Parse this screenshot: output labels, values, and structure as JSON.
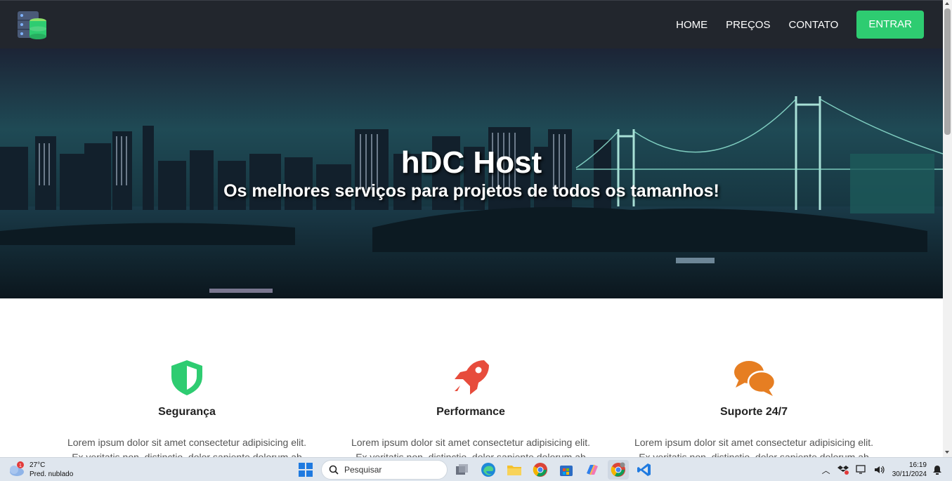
{
  "nav": {
    "links": [
      "HOME",
      "PREÇOS",
      "CONTATO"
    ],
    "button": "ENTRAR",
    "accent": "#2ecc71"
  },
  "hero": {
    "title": "hDC Host",
    "subtitle": "Os melhores serviços para projetos de todos os tamanhos!"
  },
  "features": [
    {
      "icon": "shield-icon",
      "title": "Segurança",
      "color": "#2ecc71",
      "text": "Lorem ipsum dolor sit amet consectetur adipisicing elit. Ex veritatis non, distinctio, dolor sapiente dolorum ab delectus"
    },
    {
      "icon": "rocket-icon",
      "title": "Performance",
      "color": "#e74c3c",
      "text": "Lorem ipsum dolor sit amet consectetur adipisicing elit. Ex veritatis non, distinctio, dolor sapiente dolorum ab delectus"
    },
    {
      "icon": "chat-bubbles-icon",
      "title": "Suporte 24/7",
      "color": "#e67e22",
      "text": "Lorem ipsum dolor sit amet consectetur adipisicing elit. Ex veritatis non, distinctio, dolor sapiente dolorum ab delectus"
    }
  ],
  "taskbar": {
    "weather_temp": "27°C",
    "weather_desc": "Pred. nublado",
    "weather_badge": "1",
    "search_placeholder": "Pesquisar",
    "time": "16:19",
    "date": "30/11/2024"
  }
}
